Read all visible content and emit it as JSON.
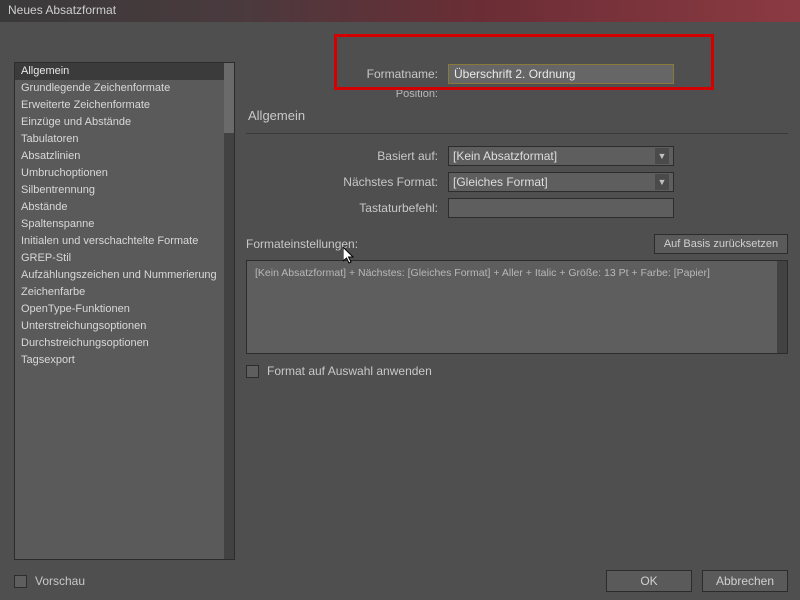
{
  "title": "Neues Absatzformat",
  "sidebar": {
    "items": [
      "Allgemein",
      "Grundlegende Zeichenformate",
      "Erweiterte Zeichenformate",
      "Einzüge und Abstände",
      "Tabulatoren",
      "Absatzlinien",
      "Umbruchoptionen",
      "Silbentrennung",
      "Abstände",
      "Spaltenspanne",
      "Initialen und verschachtelte Formate",
      "GREP-Stil",
      "Aufzählungszeichen und Nummerierung",
      "Zeichenfarbe",
      "OpenType-Funktionen",
      "Unterstreichungsoptionen",
      "Durchstreichungsoptionen",
      "Tagsexport"
    ],
    "selected": 0
  },
  "main": {
    "formatname_label": "Formatname:",
    "formatname_value": "Überschrift 2. Ordnung",
    "position_label": "Position:",
    "section_title": "Allgemein",
    "basiert_label": "Basiert auf:",
    "basiert_value": "[Kein Absatzformat]",
    "naechstes_label": "Nächstes Format:",
    "naechstes_value": "[Gleiches Format]",
    "tastatur_label": "Tastaturbefehl:",
    "tastatur_value": "",
    "settings_label": "Formateinstellungen:",
    "reset_button": "Auf Basis zurücksetzen",
    "summary": "[Kein Absatzformat] + Nächstes: [Gleiches Format] + Aller + Italic + Größe: 13 Pt + Farbe: [Papier]",
    "apply_label": "Format auf Auswahl anwenden"
  },
  "footer": {
    "preview": "Vorschau",
    "ok": "OK",
    "cancel": "Abbrechen"
  }
}
